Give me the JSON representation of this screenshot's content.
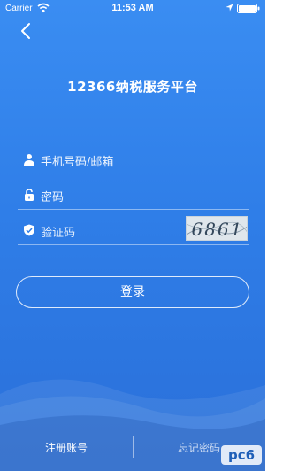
{
  "status_bar": {
    "carrier": "Carrier",
    "time": "11:53 AM"
  },
  "page": {
    "title": "12366纳税服务平台"
  },
  "form": {
    "phone_placeholder": "手机号码/邮箱",
    "password_placeholder": "密码",
    "captcha_placeholder": "验证码",
    "captcha_code": "6861",
    "login_label": "登录"
  },
  "footer": {
    "register_label": "注册账号",
    "forgot_label": "忘记密码"
  },
  "watermark": {
    "text": "pc6"
  },
  "icons": {
    "back": "chevron-left-icon",
    "wifi": "wifi-icon",
    "location": "location-arrow-icon",
    "battery": "battery-icon",
    "phone": "user-icon",
    "password": "lock-icon",
    "captcha": "shield-check-icon"
  },
  "colors": {
    "background_top": "#3a8df2",
    "background_bottom": "#2a6fd9",
    "text": "#ffffff"
  }
}
